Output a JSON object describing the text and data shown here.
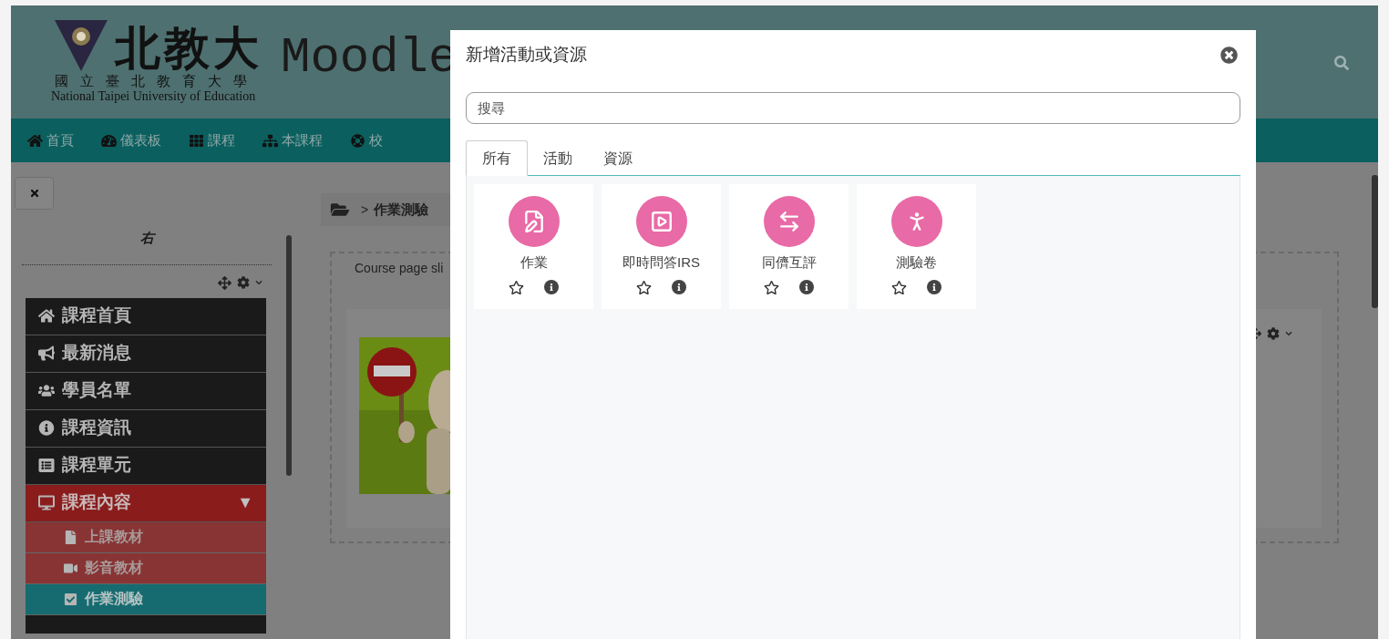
{
  "header": {
    "logo_main": "北教大",
    "logo_sub": "國立臺北教育大學",
    "logo_en": "National Taipei University of Education",
    "site_name": "Moodle"
  },
  "nav": [
    {
      "label": "首頁"
    },
    {
      "label": "儀表板"
    },
    {
      "label": "課程"
    },
    {
      "label": "本課程"
    },
    {
      "label": "校"
    }
  ],
  "sidebar": {
    "block_title": "右",
    "menu": [
      {
        "label": "課程首頁",
        "selected": false
      },
      {
        "label": "最新消息",
        "selected": false
      },
      {
        "label": "學員名單",
        "selected": false
      },
      {
        "label": "課程資訊",
        "selected": false
      },
      {
        "label": "課程單元",
        "selected": false
      },
      {
        "label": "課程內容",
        "selected": false,
        "expanded": true,
        "toggle": "▼",
        "children": [
          {
            "label": "上課教材",
            "selected": false
          },
          {
            "label": "影音教材",
            "selected": false
          },
          {
            "label": "作業測驗",
            "selected": true
          }
        ]
      }
    ]
  },
  "breadcrumb": {
    "separator": ">",
    "current": "作業測驗"
  },
  "content": {
    "block_title": "Course page sli"
  },
  "modal": {
    "title": "新增活動或資源",
    "search": {
      "placeholder": "搜尋"
    },
    "tabs": [
      {
        "label": "所有",
        "selected": true
      },
      {
        "label": "活動",
        "selected": false
      },
      {
        "label": "資源",
        "selected": false
      }
    ],
    "items": [
      {
        "label": "作業",
        "starred": false
      },
      {
        "label": "即時問答IRS",
        "starred": false
      },
      {
        "label": "同儕互評",
        "starred": false
      },
      {
        "label": "測驗卷",
        "starred": false
      }
    ]
  }
}
